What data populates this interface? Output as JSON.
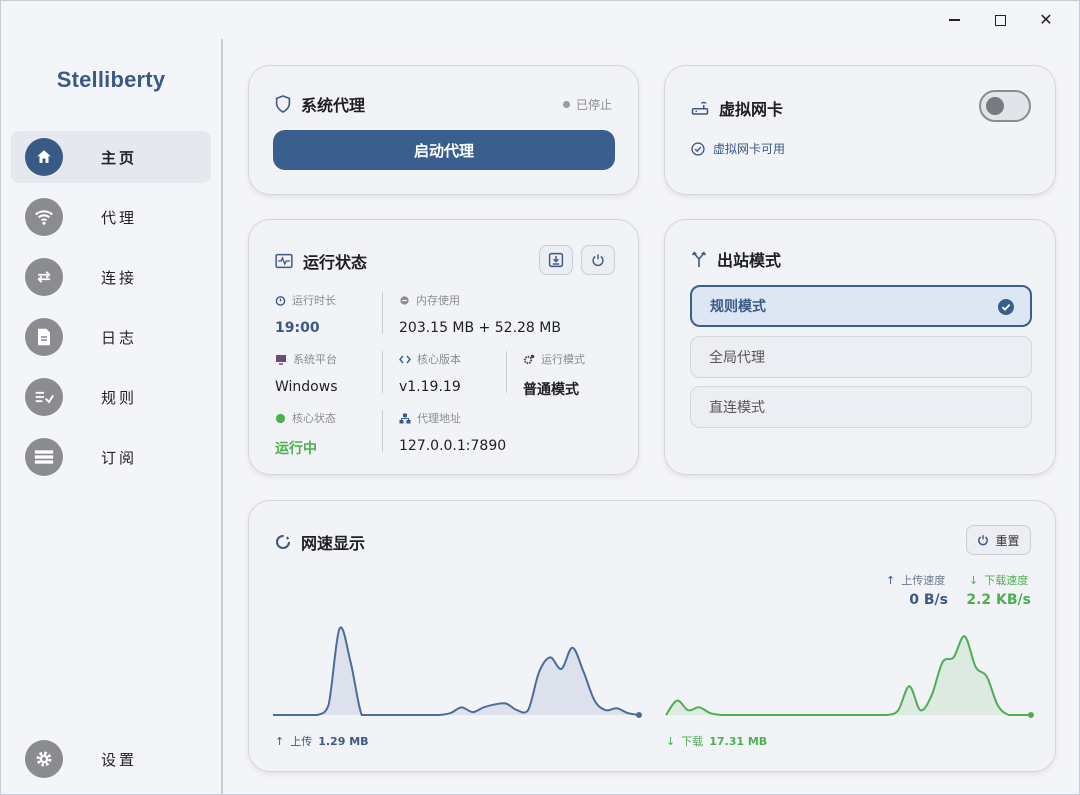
{
  "window": {
    "controls": [
      "minimize",
      "maximize",
      "close"
    ],
    "close_glyph": "✕"
  },
  "app": {
    "name": "Stelliberty"
  },
  "nav": {
    "items": [
      {
        "id": "home",
        "label": "主页",
        "icon": "home-icon",
        "active": true
      },
      {
        "id": "proxy",
        "label": "代理",
        "icon": "wifi-icon"
      },
      {
        "id": "connections",
        "label": "连接",
        "icon": "swap-icon"
      },
      {
        "id": "logs",
        "label": "日志",
        "icon": "document-icon"
      },
      {
        "id": "rules",
        "label": "规则",
        "icon": "rules-icon"
      },
      {
        "id": "subscriptions",
        "label": "订阅",
        "icon": "list-icon"
      }
    ],
    "settings_label": "设置"
  },
  "system_proxy": {
    "title": "系统代理",
    "status": "已停止",
    "start_button": "启动代理"
  },
  "tun": {
    "title": "虚拟网卡",
    "enabled": false,
    "status": "虚拟网卡可用"
  },
  "runtime": {
    "title": "运行状态",
    "uptime_label": "运行时长",
    "uptime": "19:00",
    "memory_label": "内存使用",
    "memory": "203.15 MB + 52.28 MB",
    "platform_label": "系统平台",
    "platform": "Windows",
    "core_version_label": "核心版本",
    "core_version": "v1.19.19",
    "run_mode_label": "运行模式",
    "run_mode": "普通模式",
    "core_status_label": "核心状态",
    "core_status": "运行中",
    "proxy_address_label": "代理地址",
    "proxy_address": "127.0.0.1:7890"
  },
  "outbound": {
    "title": "出站模式",
    "options": [
      {
        "label": "规则模式",
        "selected": true
      },
      {
        "label": "全局代理",
        "selected": false
      },
      {
        "label": "直连模式",
        "selected": false
      }
    ]
  },
  "speed": {
    "title": "网速显示",
    "reset_label": "重置",
    "upload_speed_label": "上传速度",
    "download_speed_label": "下载速度",
    "upload_speed": "0 B/s",
    "download_speed": "2.2 KB/s",
    "upload_total_label": "上传",
    "upload_total": "1.29 MB",
    "download_total_label": "下载",
    "download_total": "17.31 MB",
    "colors": {
      "upload": "#4a6d9a",
      "download": "#4caf50"
    }
  },
  "chart_data": [
    {
      "type": "area",
      "series": [
        {
          "name": "上传",
          "values": [
            0,
            0,
            0,
            0,
            0,
            0.1,
            0.9,
            0.55,
            0,
            0,
            0,
            0,
            0,
            0,
            0,
            0,
            0.02,
            0.08,
            0.03,
            0.08,
            0.11,
            0.12,
            0.05,
            0.05,
            0.45,
            0.6,
            0.48,
            0.7,
            0.45,
            0.15,
            0.05,
            0.07,
            0.02,
            0
          ]
        }
      ]
    },
    {
      "type": "area",
      "series": [
        {
          "name": "下载",
          "values": [
            0,
            0.15,
            0.05,
            0.08,
            0.02,
            0,
            0,
            0,
            0,
            0,
            0,
            0,
            0,
            0,
            0,
            0,
            0,
            0,
            0,
            0,
            0,
            0.05,
            0.3,
            0.05,
            0.2,
            0.55,
            0.6,
            0.82,
            0.5,
            0.4,
            0.1,
            0,
            0,
            0
          ]
        }
      ]
    }
  ]
}
